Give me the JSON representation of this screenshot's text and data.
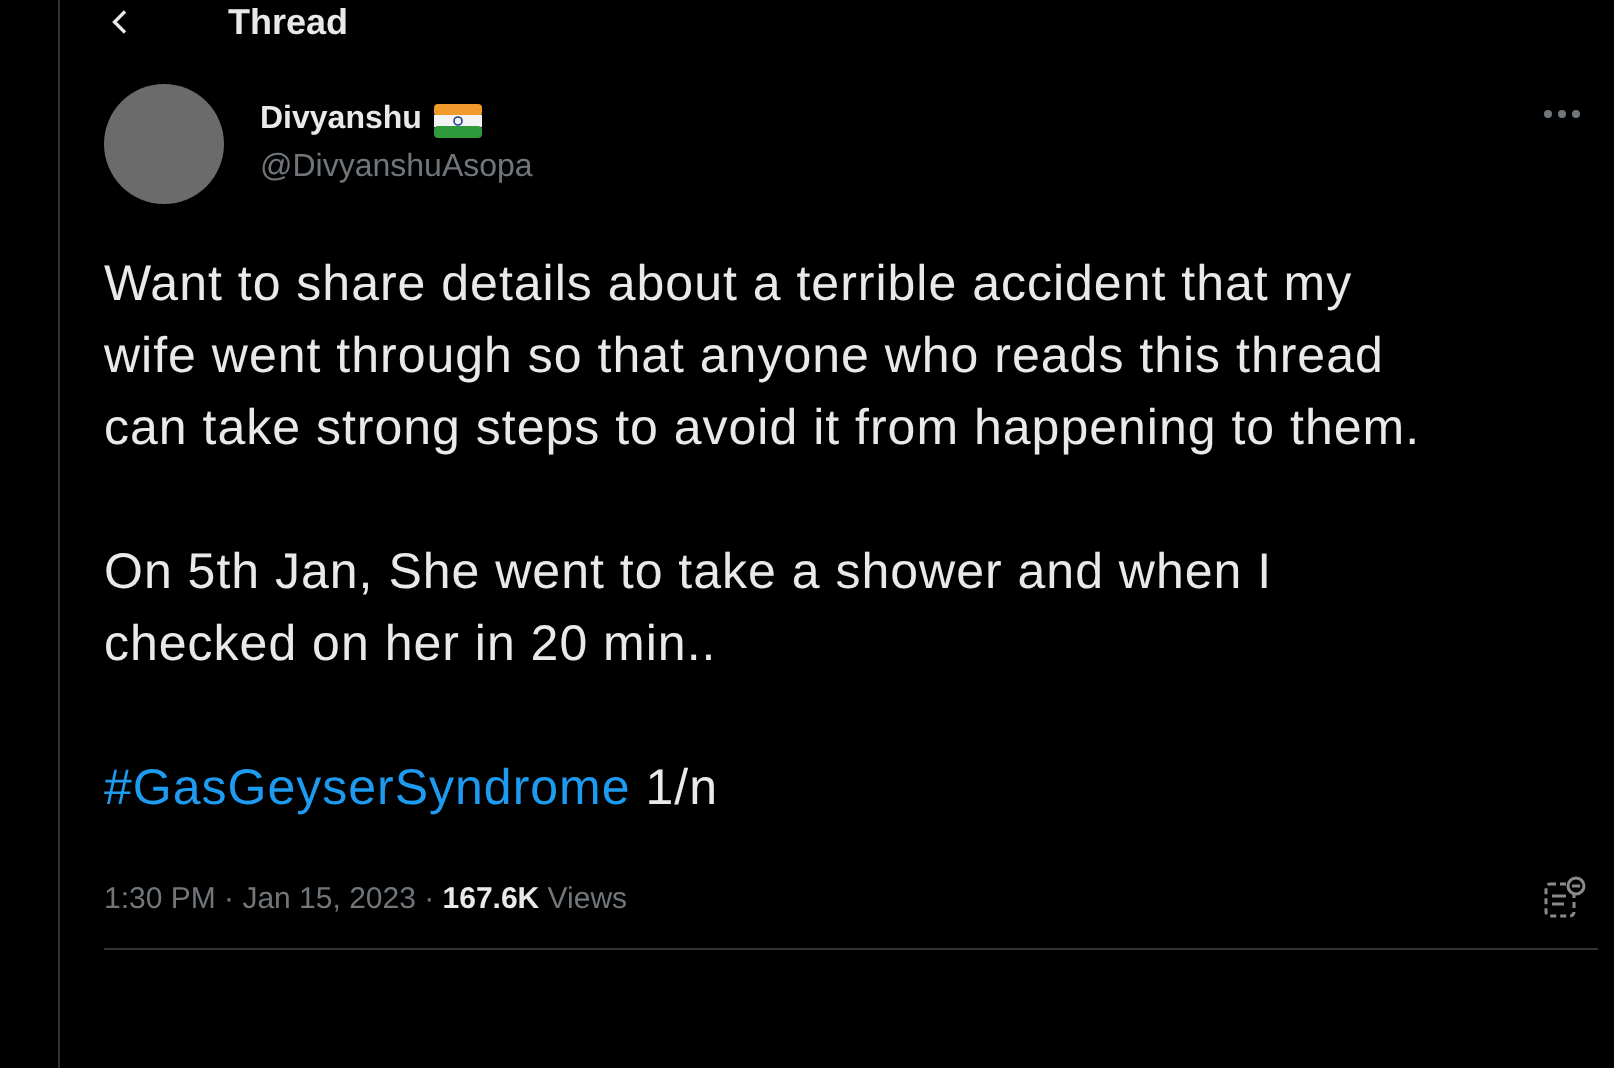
{
  "header": {
    "title": "Thread"
  },
  "tweet": {
    "name": "Divyanshu",
    "handle": "@DivyanshuAsopa",
    "paragraphs": [
      "Want to share details about a terrible accident that my wife went through so that anyone who reads this thread can take strong steps to avoid it from happening to them.",
      "On 5th Jan, She went to take a shower and when I checked on her in 20 min.."
    ],
    "hashtag": "#GasGeyserSyndrome",
    "hashtag_suffix": "1/n",
    "meta": "1:30 PM · Jan 15, 2023 · **167.6K** Views"
  }
}
